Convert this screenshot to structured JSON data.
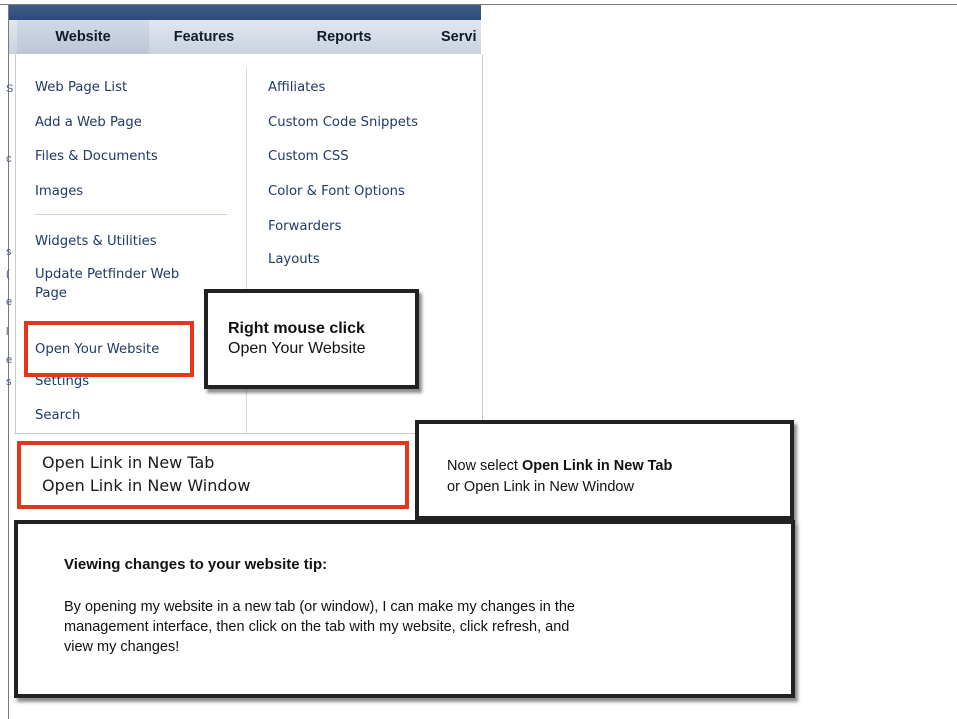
{
  "nav": {
    "tabs": [
      {
        "label": "Website"
      },
      {
        "label": "Features"
      },
      {
        "label": "Reports"
      },
      {
        "label": "Servi"
      }
    ]
  },
  "menu": {
    "left": [
      "Web Page List",
      "Add a Web Page",
      "Files & Documents",
      "Images",
      "Widgets & Utilities",
      "Update Petfinder Web",
      "Page",
      "Open Your Website",
      "Settings",
      "Search"
    ],
    "right": [
      "Affiliates",
      "Custom Code Snippets",
      "Custom CSS",
      "Color & Font Options",
      "Forwarders",
      "Layouts"
    ]
  },
  "ghost_chars": [
    "S",
    "c",
    "s",
    "(",
    "e",
    "l",
    "e",
    "s"
  ],
  "callout_right_click": {
    "title": "Right mouse click",
    "body": "Open Your Website"
  },
  "context_menu": {
    "items": [
      "Open Link in New Tab",
      "Open Link in New Window"
    ]
  },
  "callout_select": {
    "prefix": "Now select ",
    "bold": "Open Link in New Tab",
    "line2": "or Open Link in New Window"
  },
  "tip": {
    "heading": "Viewing changes to your website tip:",
    "line1": "By opening my website in a new tab (or window), I can make my changes in the",
    "line2": "management interface, then click on the tab with my website, click refresh, and",
    "line3": "view my changes!"
  },
  "colors": {
    "nav_dark": "#2c4a77",
    "link": "#1f3a66",
    "highlight_red": "#e8361a",
    "callout_border": "#222222"
  }
}
